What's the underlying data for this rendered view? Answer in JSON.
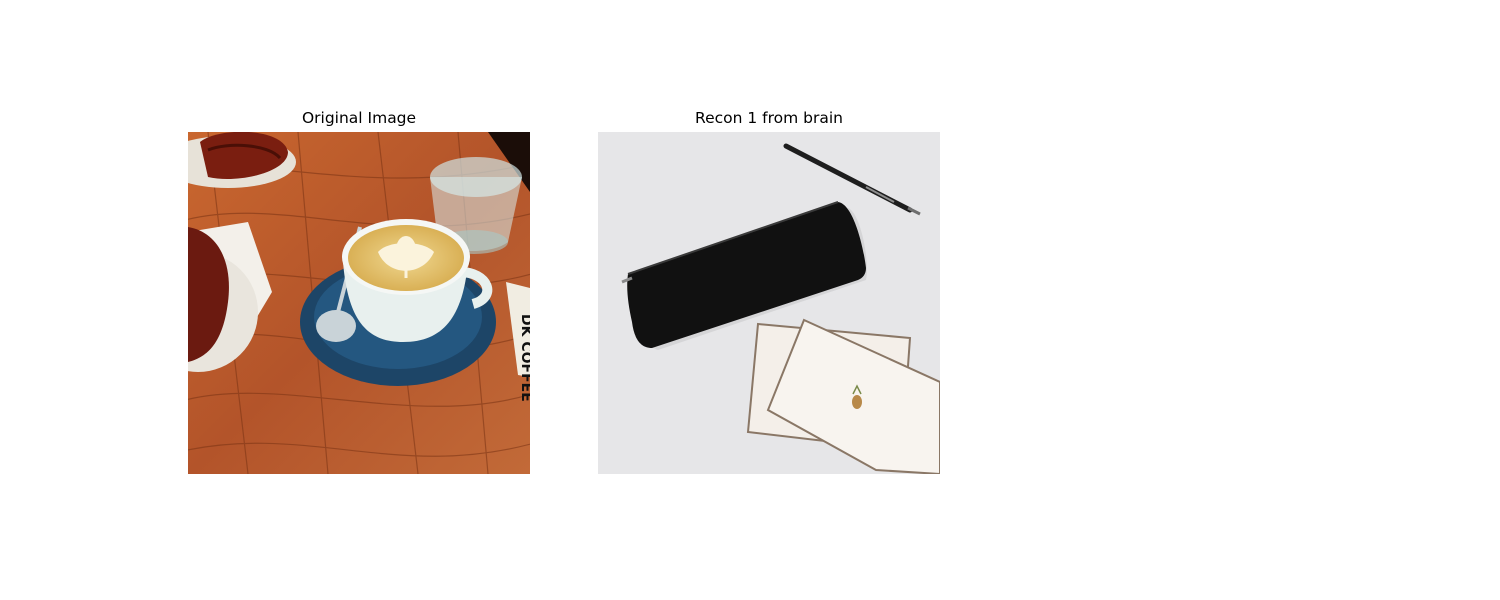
{
  "panels": [
    {
      "title": "Original Image",
      "subject": "latte-on-wooden-cafe-table"
    },
    {
      "title": "Recon 1 from brain",
      "subject": "pencil-case-pen-and-cards-on-white"
    }
  ],
  "photo_text": {
    "cup_card": "DK COFFEE"
  },
  "colors": {
    "background": "#ffffff",
    "wood": "#b5582a",
    "saucer": "#1f4a6e",
    "latte": "#e9c66c",
    "desk": "#e6e6e8",
    "pouch": "#111111"
  }
}
